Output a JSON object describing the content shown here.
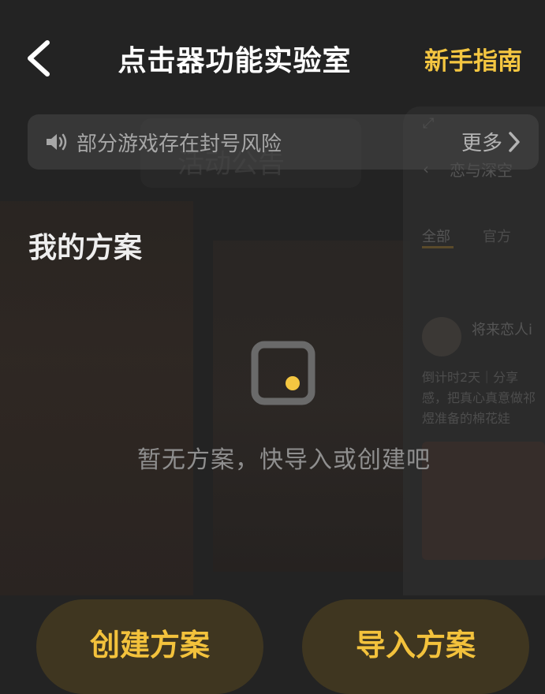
{
  "header": {
    "title": "点击器功能实验室",
    "guide_link": "新手指南"
  },
  "notice": {
    "text": "部分游戏存在封号风险",
    "more": "更多"
  },
  "section": {
    "title": "我的方案",
    "empty_text": "暂无方案，快导入或创建吧"
  },
  "buttons": {
    "create": "创建方案",
    "import": "导入方案"
  },
  "background": {
    "banner_text": "活动公告",
    "panel_title": "恋与深空",
    "tab_all": "全部",
    "tab_official": "官方",
    "user_name": "将来恋人i",
    "post_text": "倒计时2天｜分享感，把真心真意做祁煜准备的棉花娃"
  },
  "colors": {
    "accent": "#f4c641",
    "button_bg": "#3f3620",
    "background": "#232323"
  },
  "icons": {
    "back": "chevron-left-icon",
    "speaker": "speaker-icon",
    "more": "chevron-right-icon",
    "empty": "empty-box-icon"
  }
}
